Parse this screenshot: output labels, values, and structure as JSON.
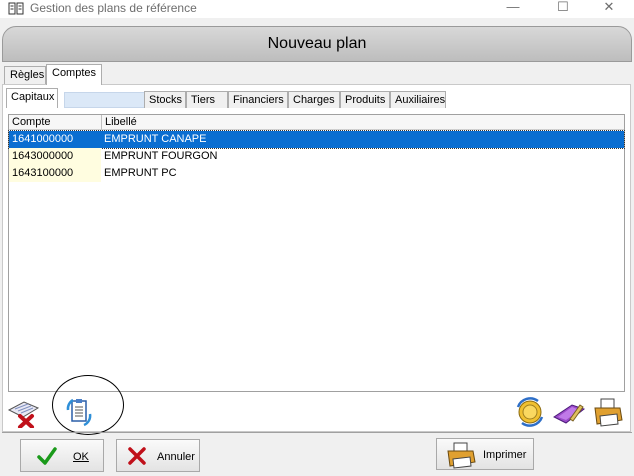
{
  "window": {
    "title": "Gestion des plans de référence",
    "minimize_glyph": "—",
    "maximize_glyph": "☐",
    "close_glyph": "✕",
    "icon": "book-icon"
  },
  "banner": {
    "title": "Nouveau plan"
  },
  "outer_tabs": [
    {
      "label": "Règles",
      "active": false
    },
    {
      "label": "Comptes",
      "active": true
    }
  ],
  "inner_tabs": [
    {
      "label": "Capitaux",
      "active": true
    },
    {
      "label": "Stocks",
      "active": false
    },
    {
      "label": "Tiers",
      "active": false
    },
    {
      "label": "Financiers",
      "active": false
    },
    {
      "label": "Charges",
      "active": false
    },
    {
      "label": "Produits",
      "active": false
    },
    {
      "label": "Auxiliaires",
      "active": false
    }
  ],
  "grid": {
    "columns": [
      "Compte",
      "Libellé"
    ],
    "rows": [
      {
        "compte": "1641000000",
        "libelle": "EMPRUNT CANAPE",
        "selected": true
      },
      {
        "compte": "1643000000",
        "libelle": "EMPRUNT FOURGON",
        "selected": false
      },
      {
        "compte": "1643100000",
        "libelle": "EMPRUNT PC",
        "selected": false
      }
    ]
  },
  "toolbar_icons": {
    "left": [
      "delete-list-icon",
      "refresh-clipboard-icon"
    ],
    "right": [
      "refresh-coins-icon",
      "folder-edit-icon",
      "printer-icon"
    ]
  },
  "buttons": {
    "ok": "OK",
    "cancel": "Annuler",
    "print": "Imprimer"
  },
  "colors": {
    "selection": "#0a6ed1",
    "code_column": "#fffde0",
    "filter_box": "#dbe8f7"
  }
}
